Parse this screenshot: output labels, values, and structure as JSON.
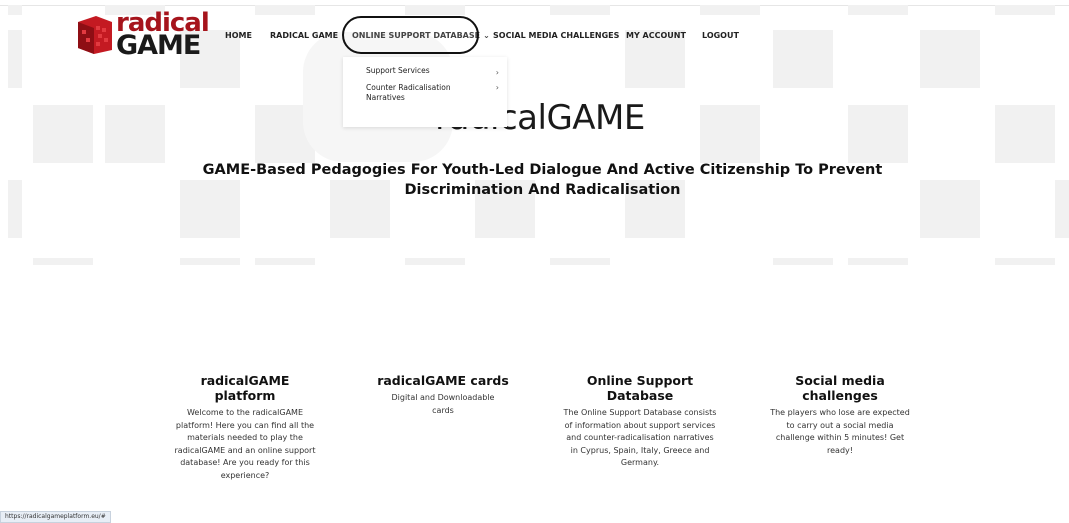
{
  "logo": {
    "line1": "radical",
    "line2": "GAME"
  },
  "nav": {
    "items": [
      {
        "label": "HOME"
      },
      {
        "label": "RADICAL GAME"
      },
      {
        "label": "ONLINE SUPPORT DATABASE"
      },
      {
        "label": "SOCIAL MEDIA CHALLENGES"
      },
      {
        "label": "MY ACCOUNT"
      },
      {
        "label": "LOGOUT"
      }
    ],
    "dropdown": [
      {
        "label": "Support Services",
        "arrow": "›"
      },
      {
        "label": "Counter Radicalisation Narratives",
        "arrow": "›"
      }
    ],
    "chevron": "⌄"
  },
  "hero": {
    "title": "radicalGAME",
    "subtitle": "GAME-Based Pedagogies For Youth-Led Dialogue And Active Citizenship To Prevent Discrimination And Radicalisation"
  },
  "cards": [
    {
      "title": "radicalGAME platform",
      "text": "Welcome to the radicalGAME platform! Here you can find all the materials needed to play the radicalGAME and an online support database! Are you ready for this experience?"
    },
    {
      "title": "radicalGAME cards",
      "text": "Digital and Downloadable cards"
    },
    {
      "title": "Online Support Database",
      "text": "The Online Support Database consists of information about support services and counter-radicalisation narratives in Cyprus, Spain, Italy, Greece and Germany."
    },
    {
      "title": "Social media challenges",
      "text": "The players who lose are expected to carry out a social media challenge within 5 minutes! Get ready!"
    }
  ],
  "status_url": "https://radicalgameplatform.eu/#",
  "colors": {
    "brand_red": "#a6141c",
    "tile_grey": "#f1f1f1"
  }
}
